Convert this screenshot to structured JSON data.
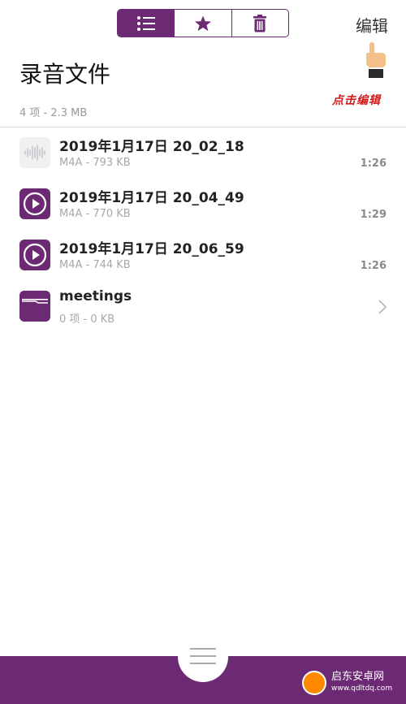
{
  "header": {
    "tabs": [
      {
        "name": "list",
        "icon": "list-icon",
        "active": true
      },
      {
        "name": "favorites",
        "icon": "star-icon",
        "active": false
      },
      {
        "name": "trash",
        "icon": "trash-icon",
        "active": false
      }
    ],
    "edit_label": "编辑",
    "annotation": "点击编辑"
  },
  "page": {
    "title": "录音文件",
    "summary": "4 项 - 2.3 MB"
  },
  "items": [
    {
      "name": "2019年1月17日 20_02_18",
      "meta": "M4A - 793 KB",
      "duration": "1:26",
      "thumb": "waveform-icon"
    },
    {
      "name": "2019年1月17日 20_04_49",
      "meta": "M4A - 770 KB",
      "duration": "1:29",
      "thumb": "play-icon"
    },
    {
      "name": "2019年1月17日 20_06_59",
      "meta": "M4A - 744 KB",
      "duration": "1:26",
      "thumb": "play-icon"
    },
    {
      "name": "meetings",
      "meta": "0 项 - 0 KB",
      "thumb": "folder-icon"
    }
  ],
  "watermark": {
    "title": "启东安卓网",
    "url": "www.qdltdq.com"
  },
  "colors": {
    "brand": "#6b2a73",
    "annotation": "#d11a1a"
  }
}
